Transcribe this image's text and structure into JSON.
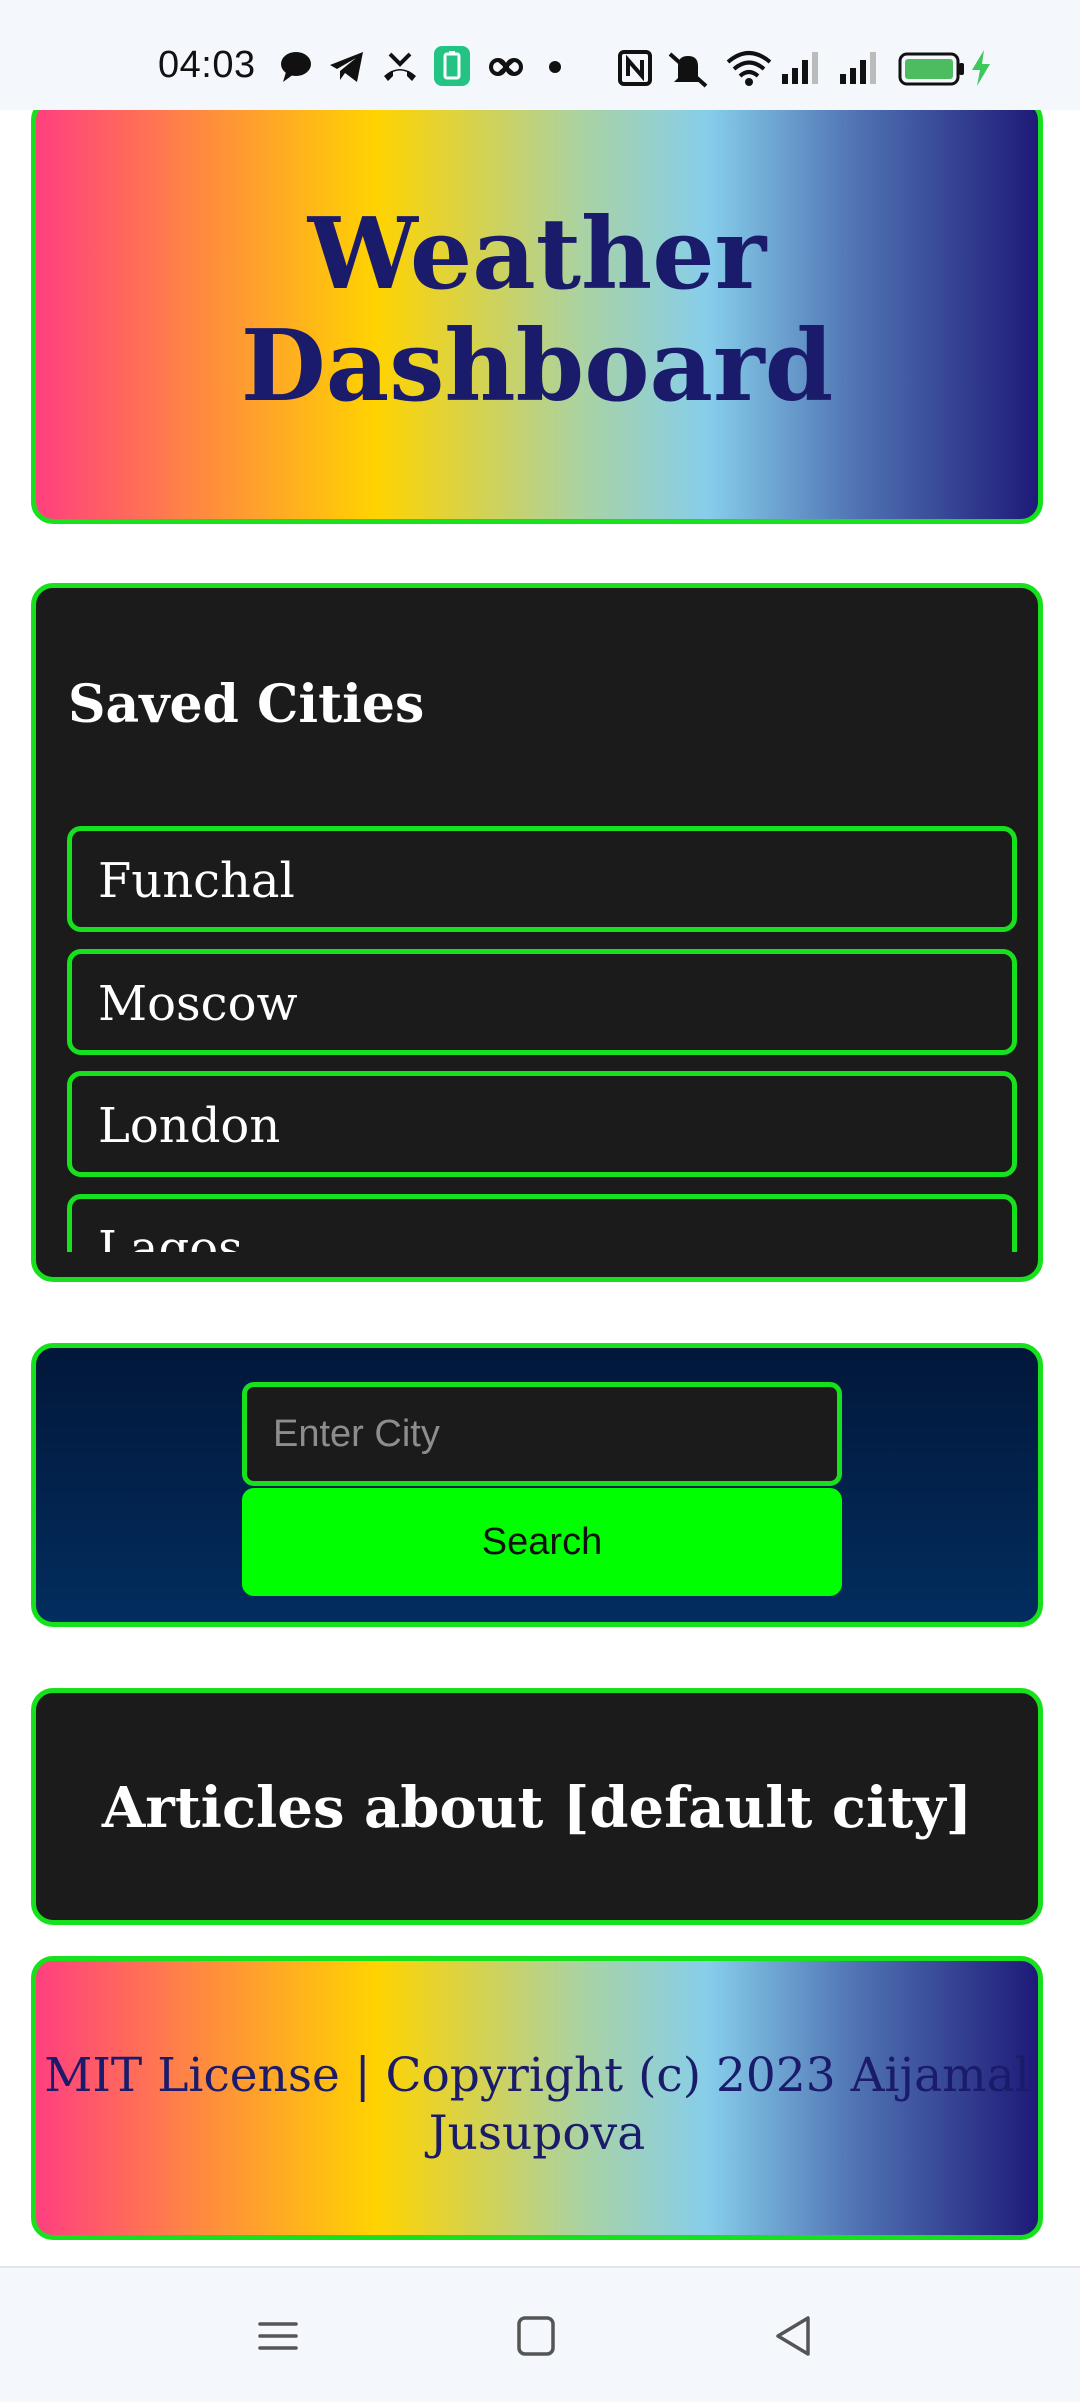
{
  "status_bar": {
    "time": "04:03"
  },
  "header": {
    "title": "Weather Dashboard"
  },
  "saved_cities": {
    "heading": "Saved Cities",
    "items": [
      {
        "label": "Funchal"
      },
      {
        "label": "Moscow"
      },
      {
        "label": "London"
      },
      {
        "label": "Lagos"
      }
    ]
  },
  "search": {
    "placeholder": "Enter City",
    "value": "",
    "button_label": "Search"
  },
  "articles": {
    "heading": "Articles about [default city]"
  },
  "footer": {
    "text": "MIT License | Copyright (c) 2023 Aijamal Jusupova"
  },
  "colors": {
    "accent_border": "#17e01d",
    "search_button": "#00ff00",
    "title_text": "#1b1b6b",
    "card_dark": "#1b1b1b"
  },
  "icons": {
    "status_left": [
      "chat-bubble-icon",
      "telegram-icon",
      "missed-call-icon",
      "battery-app-icon",
      "link-icon",
      "dot-icon"
    ],
    "status_right": [
      "nfc-icon",
      "mute-icon",
      "wifi-icon",
      "signal-icon",
      "signal-icon",
      "battery-icon",
      "charging-icon"
    ],
    "nav": [
      "menu-icon",
      "home-icon",
      "back-icon"
    ]
  }
}
